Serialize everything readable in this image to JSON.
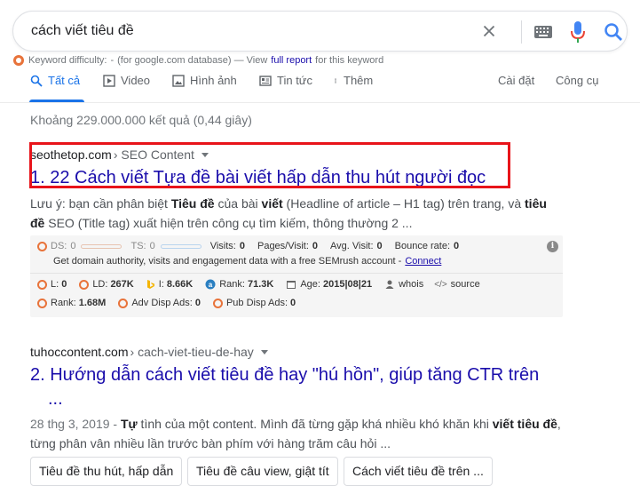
{
  "search": {
    "query": "cách viết tiêu đề",
    "icons": [
      "close-icon",
      "keyboard-icon",
      "mic-icon",
      "search-icon"
    ]
  },
  "keyword_difficulty": {
    "label": "Keyword difficulty:",
    "value": "-",
    "database": "(for google.com database) — View",
    "link": "full report",
    "suffix": "for this keyword"
  },
  "tabs": [
    {
      "label": "Tất cả",
      "icon": "search-icon",
      "active": true
    },
    {
      "label": "Video",
      "icon": "video-icon"
    },
    {
      "label": "Hình ảnh",
      "icon": "image-icon"
    },
    {
      "label": "Tin tức",
      "icon": "news-icon"
    },
    {
      "label": "Thêm",
      "icon": "more-vert-icon"
    },
    {
      "label": "Cài đặt"
    },
    {
      "label": "Công cụ"
    }
  ],
  "stats": "Khoảng 229.000.000 kết quả (0,44 giây)",
  "results": [
    {
      "domain": "seothetop.com",
      "path": "› SEO Content",
      "title": "1. 22 Cách viết Tựa đề bài viết hấp dẫn thu hút người đọc",
      "snippet_parts": [
        "Lưu ý: bạn cần phân biệt ",
        "Tiêu đề",
        " của bài ",
        "viết",
        " (Headline of article – H1 tag) trên trang, và ",
        "tiêu đề",
        " SEO (Title tag) xuất hiện trên công cụ tìm kiếm, thông thường 2 ..."
      ]
    },
    {
      "domain": "tuhoccontent.com",
      "path": "› cach-viet-tieu-de-hay",
      "title_line1": "2. Hướng dẫn cách viết tiêu đề hay \"hú hồn\", giúp tăng CTR trên",
      "title_line2": "...",
      "date": "28 thg 3, 2019 - ",
      "snippet_parts": [
        "Tự",
        " tình của một content. Mình đã từng gặp khá nhiều khó khăn khi ",
        "viết tiêu đề",
        ",",
        "từng phân vân nhiều lần trước bàn phím với hàng trăm câu hỏi ..."
      ]
    }
  ],
  "seo_panel": {
    "row1": {
      "ds_label": "DS:",
      "ds": "0",
      "ts_label": "TS:",
      "ts": "0",
      "visits_label": "Visits:",
      "visits": "0",
      "pages_label": "Pages/Visit:",
      "pages": "0",
      "avg_label": "Avg. Visit:",
      "avg": "0",
      "bounce_label": "Bounce rate:",
      "bounce": "0"
    },
    "row2": {
      "text_pre": "Get domain authority, visits and engagement data with a free SEMrush account - ",
      "link": "Connect"
    },
    "row3": {
      "l_label": "L:",
      "l": "0",
      "ld_label": "LD:",
      "ld": "267K",
      "i_label": "I:",
      "i": "8.66K",
      "rank_label": "Rank:",
      "rank": "71.3K",
      "age_label": "Age:",
      "age": "2015|08|21",
      "whois": "whois",
      "source": "source"
    },
    "row4": {
      "rank_label": "Rank:",
      "rank": "1.68M",
      "adv_label": "Adv Disp Ads:",
      "adv": "0",
      "pub_label": "Pub Disp Ads:",
      "pub": "0"
    }
  },
  "chips": [
    "Tiêu đề thu hút, hấp dẫn",
    "Tiêu đề câu view, giật tít",
    "Cách viết tiêu đề trên ..."
  ],
  "colors": {
    "link": "#1a0dab",
    "accent": "#1a73e8",
    "highlight": "#e8141a",
    "semrush": "#e8733a"
  }
}
